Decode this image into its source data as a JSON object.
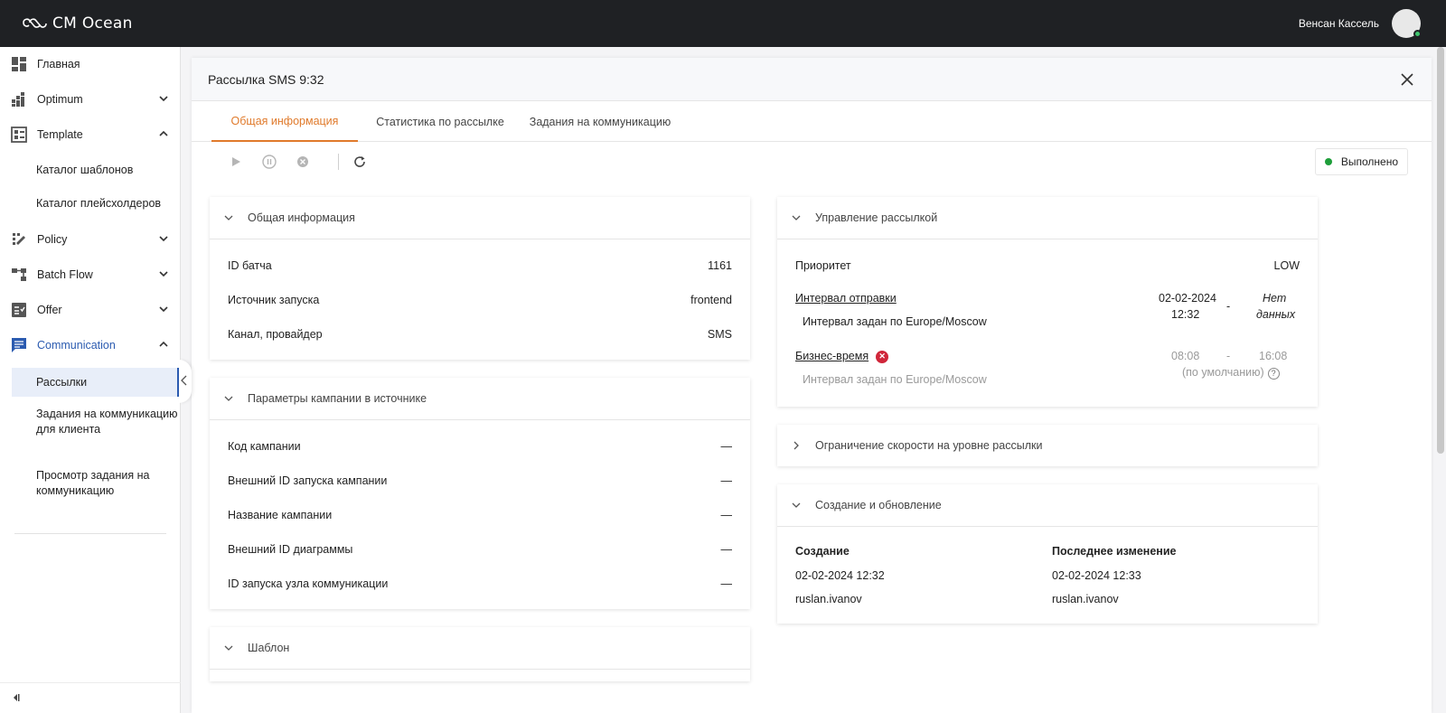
{
  "app": {
    "brand": "CM Ocean"
  },
  "user": {
    "name": "Венсан Кассель"
  },
  "sidebar": {
    "items": [
      {
        "label": "Главная"
      },
      {
        "label": "Optimum"
      },
      {
        "label": "Template"
      },
      {
        "label": "Policy"
      },
      {
        "label": "Batch Flow"
      },
      {
        "label": "Offer"
      },
      {
        "label": "Communication"
      }
    ],
    "template_sub": [
      "Каталог шаблонов",
      "Каталог плейсхолдеров"
    ],
    "communication_sub": [
      "Рассылки",
      "Задания на коммуникацию для клиента",
      "Просмотр задания на коммуникацию"
    ]
  },
  "panel": {
    "title": "Рассылка SMS 9:32",
    "tabs": [
      "Общая информация",
      "Статистика по рассылке",
      "Задания на коммуникацию"
    ],
    "status": "Выполнено"
  },
  "general": {
    "title": "Общая информация",
    "rows": [
      {
        "label": "ID батча",
        "value": "1161"
      },
      {
        "label": "Источник запуска",
        "value": "frontend"
      },
      {
        "label": "Канал, провайдер",
        "value": "SMS"
      }
    ]
  },
  "campaign": {
    "title": "Параметры кампании в источнике",
    "rows": [
      {
        "label": "Код кампании",
        "value": "—"
      },
      {
        "label": "Внешний ID запуска кампании",
        "value": "—"
      },
      {
        "label": "Название кампании",
        "value": "—"
      },
      {
        "label": "Внешний ID диаграммы",
        "value": "—"
      },
      {
        "label": "ID запуска узла коммуникации",
        "value": "—"
      }
    ]
  },
  "template": {
    "title": "Шаблон"
  },
  "management": {
    "title": "Управление рассылкой",
    "priority_label": "Приоритет",
    "priority_value": "LOW",
    "send_interval_label": "Интервал отправки",
    "send_interval_note": "Интервал задан по Europe/Moscow",
    "send_from_date": "02-02-2024",
    "send_from_time": "12:32",
    "send_dash": "-",
    "send_to_1": "Нет",
    "send_to_2": "данных",
    "business_label": "Бизнес-время",
    "business_note": "Интервал задан по Europe/Moscow",
    "business_from": "08:08",
    "business_dash": "-",
    "business_to": "16:08",
    "business_default": "(по умолчанию)"
  },
  "rate_limit": {
    "title": "Ограничение скорости на уровне рассылки"
  },
  "creation": {
    "title": "Создание и обновление",
    "created_label": "Создание",
    "created_date": "02-02-2024 12:32",
    "created_user": "ruslan.ivanov",
    "updated_label": "Последнее изменение",
    "updated_date": "02-02-2024 12:33",
    "updated_user": "ruslan.ivanov"
  },
  "colors": {
    "accent": "#e07a2b",
    "primary": "#2b5bb0",
    "success": "#1e9e3a",
    "error": "#d0263a",
    "topbar": "#1f2124"
  }
}
